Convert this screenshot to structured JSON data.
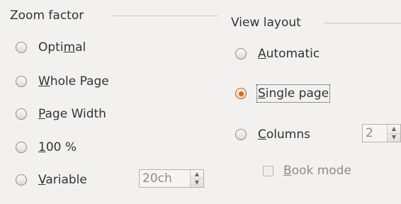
{
  "zoom": {
    "title": "Zoom factor",
    "options": [
      {
        "pre": "Opti",
        "acc": "m",
        "post": "al",
        "checked": false
      },
      {
        "pre": "",
        "acc": "W",
        "post": "hole Page",
        "checked": false
      },
      {
        "pre": "",
        "acc": "P",
        "post": "age Width",
        "checked": false
      },
      {
        "pre": "",
        "acc": "1",
        "post": "00 %",
        "checked": false
      },
      {
        "pre": "",
        "acc": "V",
        "post": "ariable",
        "checked": false
      }
    ],
    "variable_value": "20ch"
  },
  "view": {
    "title": "View layout",
    "options": [
      {
        "pre": "",
        "acc": "A",
        "post": "utomatic",
        "checked": false
      },
      {
        "pre": "",
        "acc": "S",
        "post": "ingle page",
        "checked": true
      },
      {
        "pre": "",
        "acc": "C",
        "post": "olumns",
        "checked": false
      }
    ],
    "columns_value": "2",
    "book_mode": {
      "pre": "",
      "acc": "B",
      "post": "ook mode",
      "checked": false
    }
  },
  "icons": {
    "spin_up": "▲",
    "spin_down": "▼"
  },
  "colors": {
    "radio_checked": "#e0641a",
    "disabled_text": "#8f8c88"
  }
}
